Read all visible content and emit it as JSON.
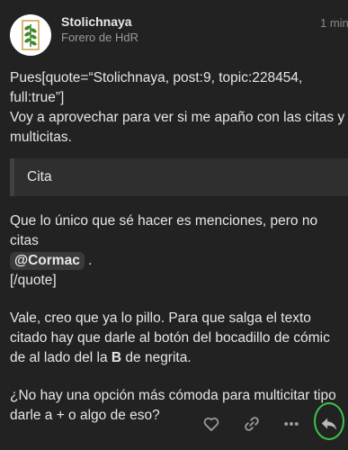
{
  "post": {
    "author": "Stolichnaya",
    "user_title": "Forero de HdR",
    "date": "1 min",
    "text_1": "Pues[quote=“Stolichnaya, post:9, topic:228454, full:true”]\nVoy a aprovechar para ver si me apaño con las citas y multicitas.",
    "quote_label": "Cita",
    "text_2_before": "Que lo único que sé hacer es menciones, pero no citas",
    "mention": "@Cormac",
    "text_2_after": " .",
    "text_3": "[/quote]",
    "text_4_before": "Vale, creo que ya lo pillo. Para que salga el texto citado hay que darle al botón del bocadillo de cómic de al lado del la ",
    "text_4_bold": "B",
    "text_4_after": " de negrita.",
    "text_5": "¿No hay una opción más cómoda para multicitar tipo darle a + o algo de eso?"
  },
  "actions": {
    "like_icon": "heart-icon",
    "link_icon": "link-icon",
    "more_icon": "more-icon",
    "reply_icon": "reply-icon"
  },
  "colors": {
    "background": "#222222",
    "quote_background": "#2f2f2f",
    "highlight_circle": "#3fc248"
  }
}
